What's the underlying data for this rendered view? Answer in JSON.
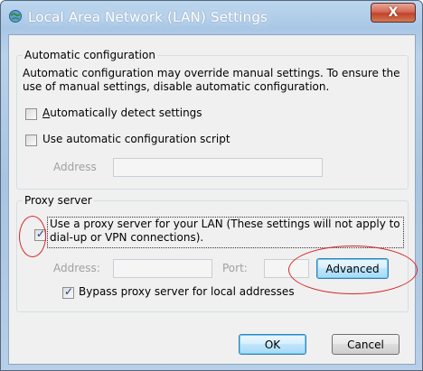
{
  "window": {
    "title": "Local Area Network (LAN) Settings",
    "close_label": "X"
  },
  "auto_config": {
    "group_title": "Automatic configuration",
    "description": "Automatic configuration may override manual settings.  To ensure the use of manual settings, disable automatic configuration.",
    "detect_settings": {
      "label": "Automatically detect settings",
      "checked": false
    },
    "use_script": {
      "label": "Use automatic configuration script",
      "checked": false
    },
    "address_label": "Address",
    "address_value": ""
  },
  "proxy": {
    "group_title": "Proxy server",
    "use_proxy": {
      "label_line1": "Use a proxy server for your LAN (These settings will not apply to",
      "label_line2": "dial-up or VPN connections).",
      "checked": true
    },
    "address_label": "Address:",
    "address_value": "",
    "port_label": "Port:",
    "port_value": "",
    "advanced_label": "Advanced",
    "bypass": {
      "label": "Bypass proxy server for local addresses",
      "checked": true
    }
  },
  "buttons": {
    "ok_label": "OK",
    "cancel_label": "Cancel"
  },
  "colors": {
    "annotation_red": "#d92626",
    "title_glow": "#ffffff"
  }
}
